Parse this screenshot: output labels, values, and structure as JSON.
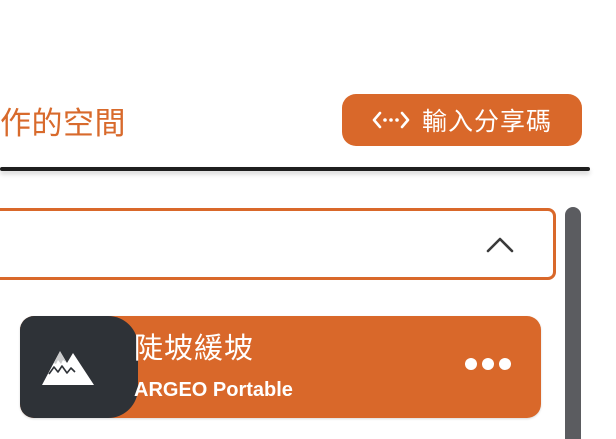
{
  "header": {
    "title": "作的空間",
    "share_code_label": "輸入分享碼"
  },
  "workspace_list": {
    "items": [
      {
        "title": "陡坡緩坡",
        "subtitle": "ARGEO Portable",
        "icon": "mountain-icon"
      }
    ]
  },
  "colors": {
    "accent": "#d9682a",
    "thumb_bg": "#2e3237",
    "divider": "#1e1e1e",
    "scrollbar": "#5b5c60"
  }
}
